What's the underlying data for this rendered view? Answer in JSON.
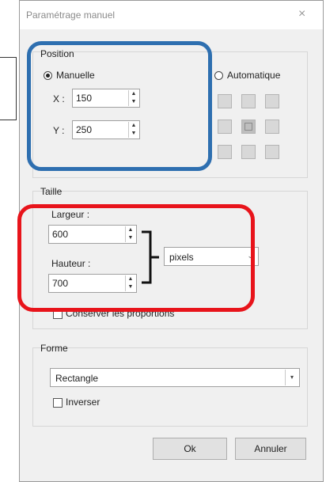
{
  "window": {
    "title": "Paramétrage manuel",
    "close_glyph": "×"
  },
  "position": {
    "group_label": "Position",
    "manual_label": "Manuelle",
    "auto_label": "Automatique",
    "x_label": "X :",
    "x_value": "150",
    "y_label": "Y :",
    "y_value": "250",
    "anchor_selected": "center"
  },
  "size": {
    "group_label": "Taille",
    "width_label": "Largeur :",
    "width_value": "600",
    "height_label": "Hauteur :",
    "height_value": "700",
    "unit_value": "pixels",
    "keep_proportions_label": "Conserver les proportions",
    "keep_proportions_checked": false
  },
  "shape": {
    "group_label": "Forme",
    "shape_value": "Rectangle",
    "invert_label": "Inverser",
    "invert_checked": false
  },
  "buttons": {
    "ok_label": "Ok",
    "cancel_label": "Annuler"
  },
  "annotations": {
    "blue_color": "#2e6fb0",
    "red_color": "#e8141b"
  }
}
